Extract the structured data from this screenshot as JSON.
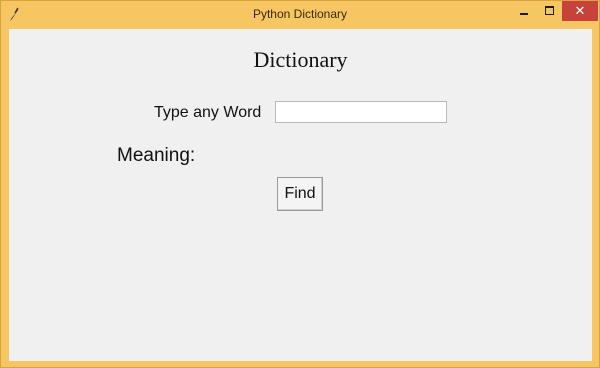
{
  "window": {
    "title": "Python Dictionary",
    "controls": {
      "minimize_icon": "minimize-icon",
      "maximize_icon": "maximize-icon",
      "close_label": "✕"
    },
    "app_icon": "feather-icon"
  },
  "main": {
    "heading": "Dictionary",
    "word_label": "Type any Word",
    "word_input_value": "",
    "meaning_label": "Meaning:",
    "find_button_label": "Find"
  },
  "colors": {
    "titlebar": "#f5c662",
    "close_button": "#c7423a",
    "client_background": "#f0f0f0"
  }
}
